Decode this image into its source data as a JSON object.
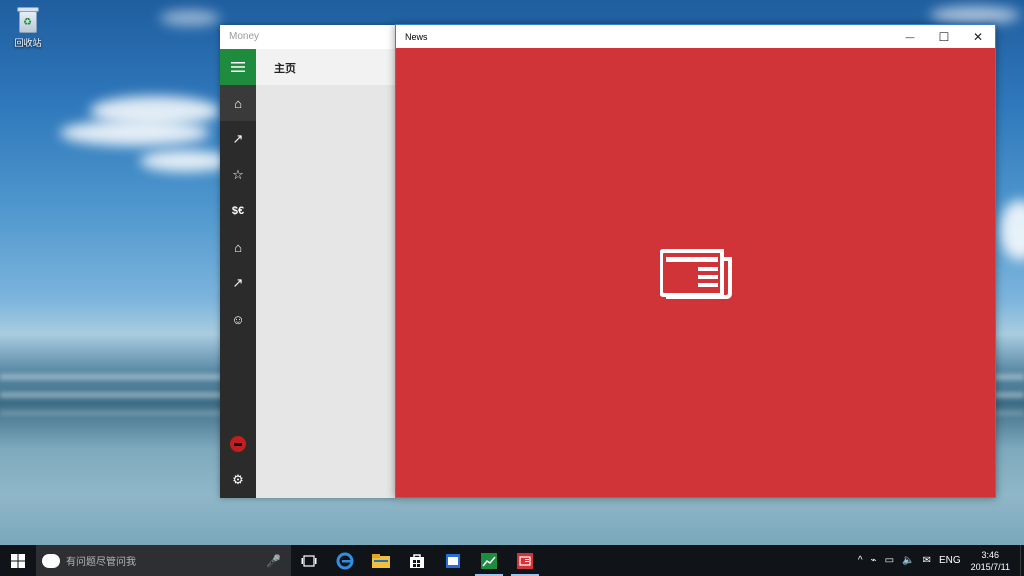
{
  "desktop": {
    "recycle_bin_label": "回收站"
  },
  "money_window": {
    "title": "Money",
    "header": "主页",
    "rail_items": [
      {
        "icon": "hamburger-icon",
        "glyph": "☰"
      },
      {
        "icon": "home-icon",
        "glyph": "⌂"
      },
      {
        "icon": "trend-icon",
        "glyph": "↗"
      },
      {
        "icon": "watchlist-icon",
        "glyph": "☆"
      },
      {
        "icon": "currency-icon",
        "glyph": "$€"
      },
      {
        "icon": "mortgage-icon",
        "glyph": "⌂"
      },
      {
        "icon": "retirement-icon",
        "glyph": "↗"
      },
      {
        "icon": "feedback-icon",
        "glyph": "☺"
      }
    ],
    "settings_glyph": "⚙"
  },
  "news_window": {
    "title": "News",
    "minimize_glyph": "—",
    "maximize_glyph": "☐",
    "close_glyph": "✕",
    "accent": "#d13438"
  },
  "taskbar": {
    "search_placeholder": "有问题尽管问我",
    "mic_glyph": "🎤",
    "tray": {
      "chevron": "^",
      "lang": "ENG",
      "time": "3:46",
      "date": "2015/7/11"
    }
  }
}
